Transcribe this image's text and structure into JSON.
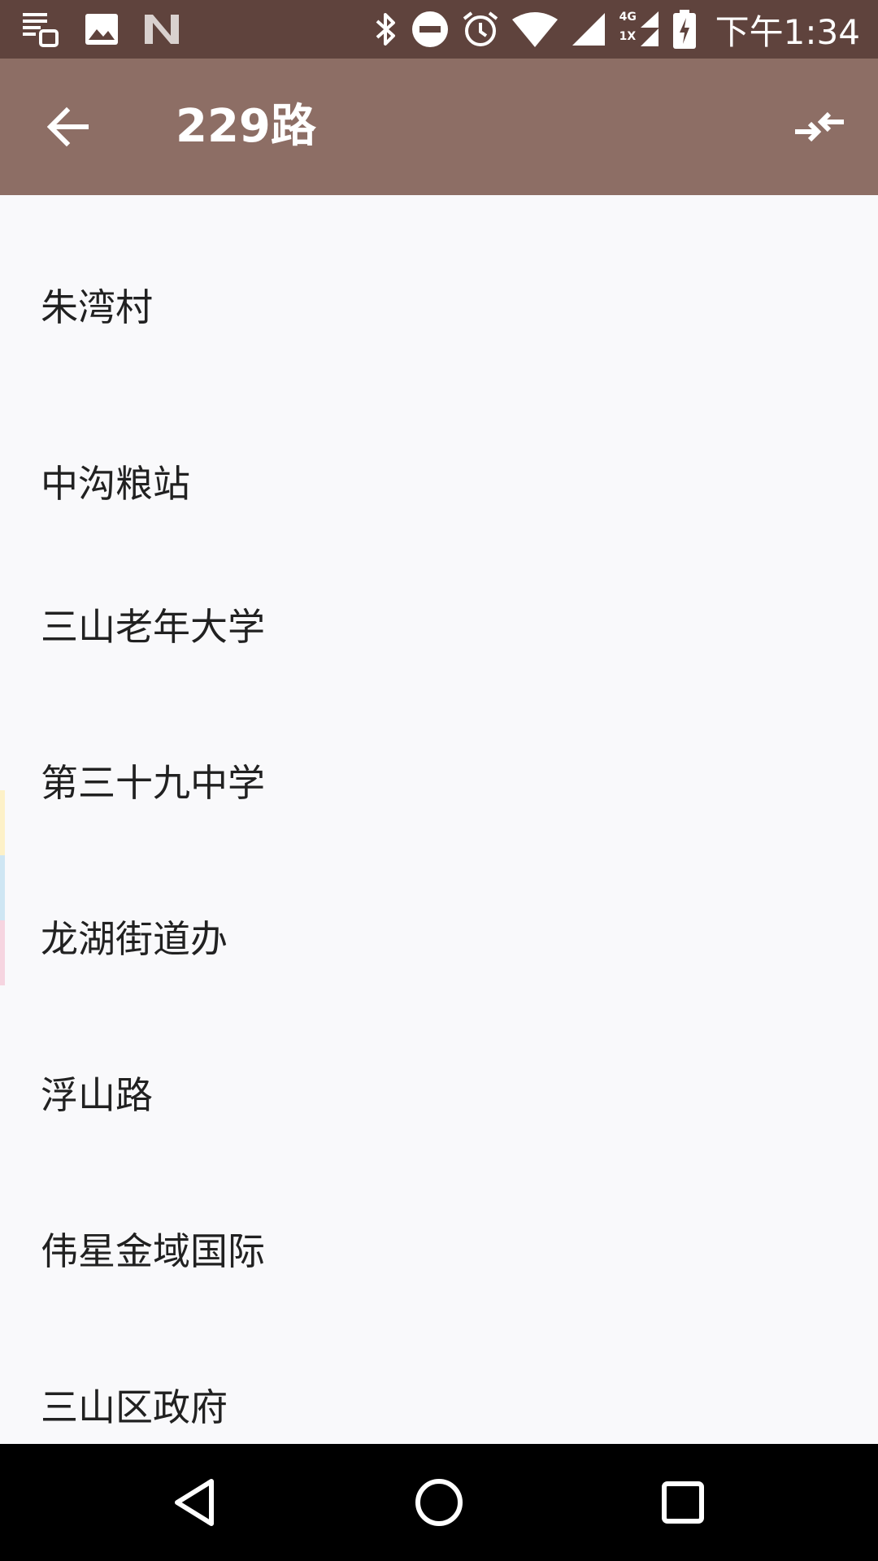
{
  "status_bar": {
    "time": "下午1:34",
    "network_label_top": "4G",
    "network_label_bottom": "1X",
    "icons": [
      "notes-icon",
      "image-icon",
      "n-logo-icon",
      "bluetooth-icon",
      "do-not-disturb-icon",
      "alarm-icon",
      "wifi-icon",
      "signal-icon",
      "dual-signal-icon",
      "battery-charging-icon"
    ]
  },
  "app_bar": {
    "title": "229路",
    "back_icon": "arrow-back-icon",
    "reverse_icon": "swap-direction-icon"
  },
  "stops": [
    {
      "name": "朱湾村"
    },
    {
      "name": "中沟粮站"
    },
    {
      "name": "三山老年大学"
    },
    {
      "name": "第三十九中学"
    },
    {
      "name": "龙湖街道办"
    },
    {
      "name": "浮山路"
    },
    {
      "name": "伟星金域国际"
    },
    {
      "name": "三山区政府"
    }
  ],
  "edge_colors": [
    "#fdf1c8",
    "#cfe6f3",
    "#f6d5e0"
  ],
  "nav_bar": {
    "icons": [
      "back-triangle-icon",
      "home-circle-icon",
      "recents-square-icon"
    ]
  }
}
